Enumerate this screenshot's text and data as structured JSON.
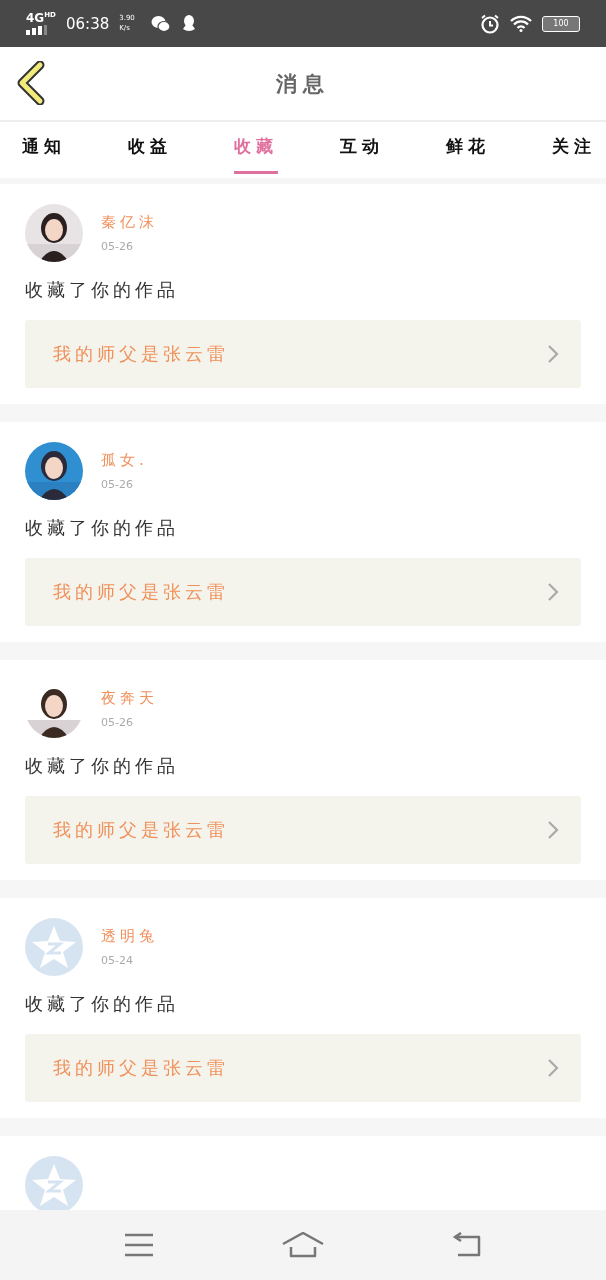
{
  "status_bar": {
    "network": "4G",
    "network_badge": "HD",
    "time": "06:38",
    "speed": "3.90",
    "speed_unit": "K/s",
    "battery": "100"
  },
  "header": {
    "title": "消息"
  },
  "tabs": [
    {
      "label": "通知",
      "selected": false
    },
    {
      "label": "收益",
      "selected": false
    },
    {
      "label": "收藏",
      "selected": true
    },
    {
      "label": "互动",
      "selected": false
    },
    {
      "label": "鲜花",
      "selected": false
    },
    {
      "label": "关注",
      "selected": false
    }
  ],
  "messages": [
    {
      "name": "秦亿沫",
      "date": "05-26",
      "text": "收藏了你的作品",
      "work": "我的师父是张云雷"
    },
    {
      "name": "孤女.",
      "date": "05-26",
      "text": "收藏了你的作品",
      "work": "我的师父是张云雷"
    },
    {
      "name": "夜奔天",
      "date": "05-26",
      "text": "收藏了你的作品",
      "work": "我的师父是张云雷"
    },
    {
      "avatar": {
        "kind": "default"
      },
      "name": "透明兔",
      "date": "05-24",
      "text": "收藏了你的作品",
      "work": "我的师父是张云雷"
    },
    {
      "avatar": {
        "kind": "default"
      }
    }
  ]
}
